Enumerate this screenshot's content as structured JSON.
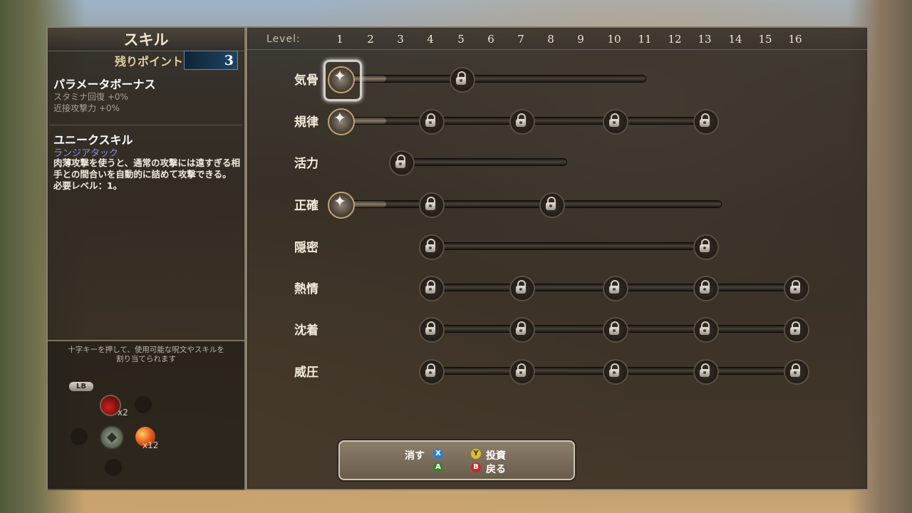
{
  "left": {
    "title": "スキル",
    "points_label": "残りポイント",
    "points_value": "3",
    "param_title": "パラメータボーナス",
    "param_lines": [
      "スタミナ回復 +0%",
      "近接攻撃力 +0%"
    ],
    "unique_title": "ユニークスキル",
    "unique_name": "ランジアタック",
    "unique_desc": "肉薄攻撃を使うと、通常の攻撃には遠すぎる相手との間合いを自動的に詰めて攻撃できる。必要レベル：1。",
    "hint_line1": "十字キーを押して、使用可能な呪文やスキルを",
    "hint_line2": "割り当てられます",
    "lb_label": "LB",
    "potion_count": "x2",
    "apple_count": "x12"
  },
  "levels": {
    "label": "Level:",
    "numbers": [
      "1",
      "2",
      "3",
      "4",
      "5",
      "6",
      "7",
      "8",
      "9",
      "10",
      "11",
      "12",
      "13",
      "14",
      "15",
      "16"
    ]
  },
  "skills": [
    {
      "name": "気骨",
      "start": 1,
      "end": 11,
      "filled_to": 2.5,
      "nodes": [
        {
          "level": 1,
          "type": "star"
        },
        {
          "level": 5,
          "type": "lock"
        }
      ]
    },
    {
      "name": "規律",
      "start": 1,
      "end": 13,
      "filled_to": 2.5,
      "nodes": [
        {
          "level": 1,
          "type": "star"
        },
        {
          "level": 4,
          "type": "lock"
        },
        {
          "level": 7,
          "type": "lock"
        },
        {
          "level": 10,
          "type": "lock"
        },
        {
          "level": 13,
          "type": "lock"
        }
      ]
    },
    {
      "name": "活力",
      "start": 3,
      "end": 8.5,
      "filled_to": 0,
      "nodes": [
        {
          "level": 3,
          "type": "lock"
        }
      ]
    },
    {
      "name": "正確",
      "start": 1,
      "end": 13.5,
      "filled_to": 2.5,
      "nodes": [
        {
          "level": 1,
          "type": "star"
        },
        {
          "level": 4,
          "type": "lock"
        },
        {
          "level": 8,
          "type": "lock"
        }
      ]
    },
    {
      "name": "隠密",
      "start": 4,
      "end": 13,
      "filled_to": 0,
      "nodes": [
        {
          "level": 4,
          "type": "lock"
        },
        {
          "level": 13,
          "type": "lock"
        }
      ]
    },
    {
      "name": "熱情",
      "start": 4,
      "end": 16,
      "filled_to": 0,
      "nodes": [
        {
          "level": 4,
          "type": "lock"
        },
        {
          "level": 7,
          "type": "lock"
        },
        {
          "level": 10,
          "type": "lock"
        },
        {
          "level": 13,
          "type": "lock"
        },
        {
          "level": 16,
          "type": "lock"
        }
      ]
    },
    {
      "name": "沈着",
      "start": 4,
      "end": 16,
      "filled_to": 0,
      "nodes": [
        {
          "level": 4,
          "type": "lock"
        },
        {
          "level": 7,
          "type": "lock"
        },
        {
          "level": 10,
          "type": "lock"
        },
        {
          "level": 13,
          "type": "lock"
        },
        {
          "level": 16,
          "type": "lock"
        }
      ]
    },
    {
      "name": "威圧",
      "start": 4,
      "end": 16,
      "filled_to": 0,
      "nodes": [
        {
          "level": 4,
          "type": "lock"
        },
        {
          "level": 7,
          "type": "lock"
        },
        {
          "level": 10,
          "type": "lock"
        },
        {
          "level": 13,
          "type": "lock"
        },
        {
          "level": 16,
          "type": "lock"
        }
      ]
    }
  ],
  "buttons": {
    "erase_label": "消す",
    "x_glyph": "X",
    "a_glyph": "A",
    "y_glyph": "Y",
    "invest_label": "投資",
    "b_glyph": "B",
    "back_label": "戻る",
    "colors": {
      "x": "#2a7fd8",
      "a": "#3f7f2a",
      "y": "#d8c22a",
      "b": "#c8262a"
    }
  }
}
